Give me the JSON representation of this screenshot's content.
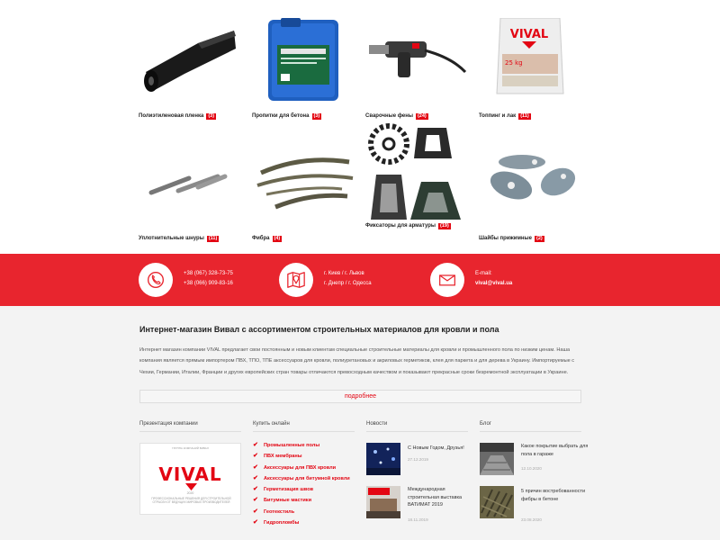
{
  "products": [
    {
      "name": "Полиэтиленовая пленка",
      "count": "(3)",
      "icon": "poly-film-roll-image"
    },
    {
      "name": "Пропитки для бетона",
      "count": "(3)",
      "icon": "concrete-impregnation-canister-image"
    },
    {
      "name": "Сварочные фены",
      "count": "(24)",
      "icon": "welding-hot-air-gun-image"
    },
    {
      "name": "Топпинг и лак",
      "count": "(11)",
      "icon": "topping-bag-image"
    },
    {
      "name": "Уплотнительные шнуры",
      "count": "(11)",
      "icon": "sealing-cords-image"
    },
    {
      "name": "Фибра",
      "count": "(4)",
      "icon": "fiber-bundles-image"
    },
    {
      "name": "Фиксаторы для арматуры",
      "count": "(19)",
      "icon": "rebar-spacers-image"
    },
    {
      "name": "Шайбы прижимные",
      "count": "(2)",
      "icon": "pressure-washers-image"
    }
  ],
  "contacts": {
    "phone_1": "+38 (067) 328-73-75",
    "phone_2": "+38 (066) 909-83-16",
    "cities_1": "г. Киев / г. Львов",
    "cities_2": "г. Днепр / г. Одесса",
    "email_label": "E-mail:",
    "email": "vival@vival.ua"
  },
  "about": {
    "title": "Интернет-магазин Вивал с ассортиментом строительных материалов для кровли и пола",
    "text": "Интернет магазин компании VIVAL предлагает свои постоянным и новым клиентам специальные строительные материалы для кровли и промышленного пола по низким ценам. Наша компания является прямым импортером ПВХ, ТПО, ТПЕ аксессуаров для кровли, полиуретановых и акриловых герметиков, клея для паркета и для дерева в Украину. Импортируемые с Чехии, Германии, Италии, Франции и других европейских стран товары отличаются превосходным качеством и показывают прекрасные сроки безремонтной эксплуатации в Украине.",
    "more_label": "подробнее"
  },
  "columns": {
    "presentation": {
      "title": "Презентация компании",
      "top_line": "ГРУППА КОМПАНИЙ ВИВАЛ",
      "brand": "VIVAL",
      "year": "2020",
      "tagline": "ПРОФЕССИОНАЛЬНЫЕ РЕШЕНИЯ ДЛЯ СТРОИТЕЛЬНОЙ ОТРАСЛИ ОТ ВЕДУЩИХ МИРОВЫХ ПРОИЗВОДИТЕЛЕЙ"
    },
    "shop": {
      "title": "Купить онлайн",
      "items": [
        "Промышленные полы",
        "ПВХ мембраны",
        "Аксессуары для ПВХ кровли",
        "Аксессуары для битумной кровли",
        "Герметизация швов",
        "Битумные мастики",
        "Геотекстиль",
        "Гидропломбы"
      ]
    },
    "news": {
      "title": "Новости",
      "items": [
        {
          "title": "С Новым Годом, Друзья!",
          "date": "27.12.2019"
        },
        {
          "title": "Международная строительная выставка ВАТИМАТ 2019",
          "date": "18.11.2019"
        }
      ]
    },
    "blog": {
      "title": "Блог",
      "items": [
        {
          "title": "Какое покрытие выбрать для пола в гараже",
          "date": "12.10.2020"
        },
        {
          "title": "5 причин востребованности фибры в бетоне",
          "date": "23.08.2020"
        }
      ]
    }
  },
  "colors": {
    "accent": "#e8252e",
    "brand_red": "#e30613"
  }
}
